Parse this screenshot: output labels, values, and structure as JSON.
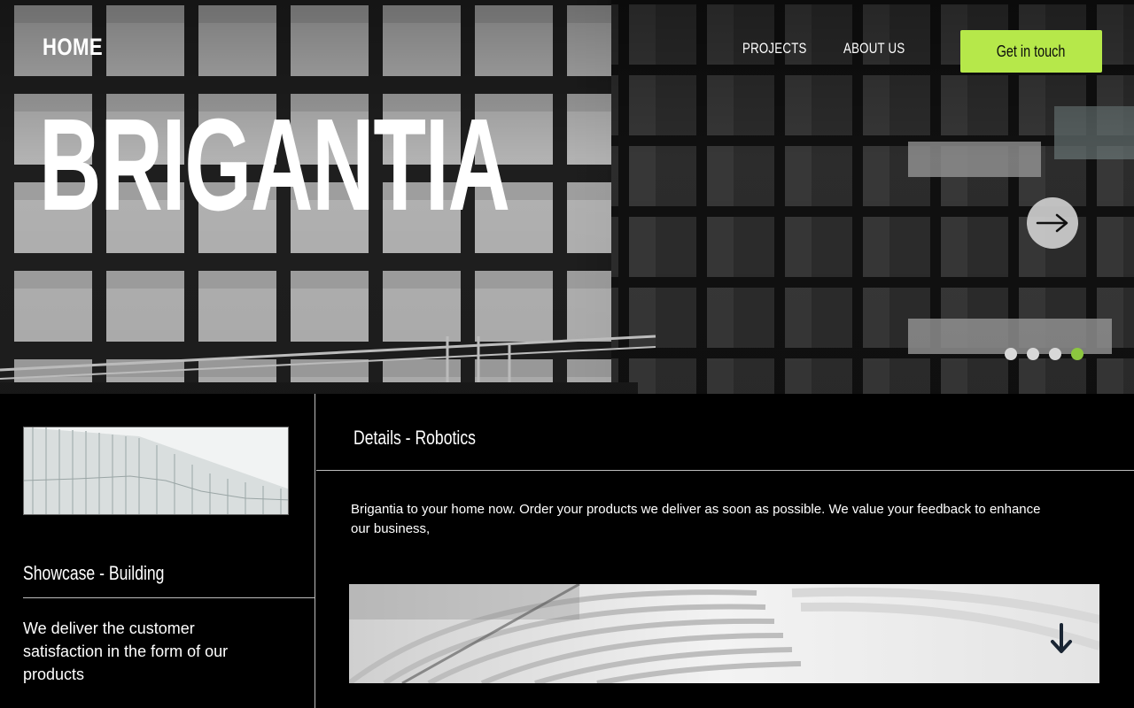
{
  "nav": {
    "home_label": "HOME",
    "projects_label": "PROJECTS",
    "about_label": "ABOUT US",
    "cta_label": "Get in touch"
  },
  "hero": {
    "title": "BRIGANTIA",
    "slide_count": 4,
    "active_slide": 4,
    "next_icon": "arrow-right-icon"
  },
  "showcase": {
    "label": "Showcase - Building",
    "text": "We deliver the customer satisfaction in the form of our products"
  },
  "details": {
    "label": "Details - Robotics",
    "text": "Brigantia to your home now. Order your products we deliver as soon as possible. We value your feedback to enhance our business,",
    "down_icon": "arrow-down-icon"
  },
  "colors": {
    "accent": "#b6e84a",
    "active_dot": "#8cc63f",
    "background": "#000000",
    "text": "#ffffff"
  }
}
